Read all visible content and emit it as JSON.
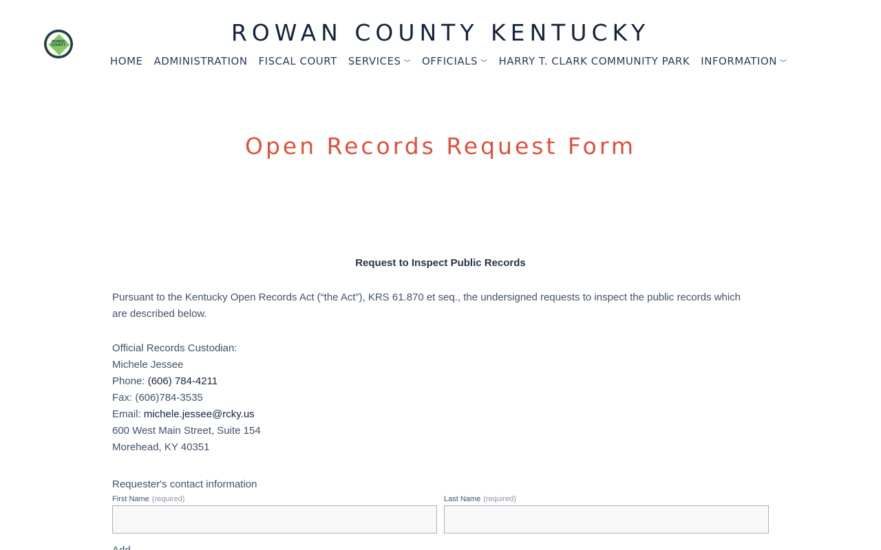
{
  "header": {
    "site_title": "ROWAN COUNTY KENTUCKY",
    "logo_text_line1": "ROWAN",
    "logo_text_line2": "COUNTY"
  },
  "nav": {
    "items": [
      {
        "label": "HOME",
        "has_dropdown": false
      },
      {
        "label": "ADMINISTRATION",
        "has_dropdown": false
      },
      {
        "label": "FISCAL COURT",
        "has_dropdown": false
      },
      {
        "label": "SERVICES",
        "has_dropdown": true
      },
      {
        "label": "OFFICIALS",
        "has_dropdown": true
      },
      {
        "label": "HARRY T. CLARK COMMUNITY PARK",
        "has_dropdown": false
      },
      {
        "label": "INFORMATION",
        "has_dropdown": true
      }
    ]
  },
  "page": {
    "title": "Open Records Request Form",
    "subheading": "Request to Inspect Public Records",
    "intro": "Pursuant to the Kentucky Open Records Act (“the Act”), KRS 61.870 et seq., the undersigned requests to inspect the public records which are described below."
  },
  "custodian": {
    "heading": "Official Records Custodian:",
    "name": "Michele Jessee",
    "phone_label": "Phone: ",
    "phone": "(606) 784-4211",
    "fax": "Fax: (606)784-3535",
    "email_label": "Email: ",
    "email": "michele.jessee@rcky.us",
    "address1": "600 West Main Street, Suite 154",
    "address2": "Morehead, KY 40351"
  },
  "form": {
    "section_label": "Requester's contact information",
    "first_name_label": "First Name",
    "last_name_label": "Last Name",
    "required_text": "(required)",
    "first_name_value": "",
    "last_name_value": "",
    "next_label_partial": "Add"
  },
  "colors": {
    "title_red": "#e0503a",
    "navy": "#14233a",
    "text": "#3f5268"
  }
}
